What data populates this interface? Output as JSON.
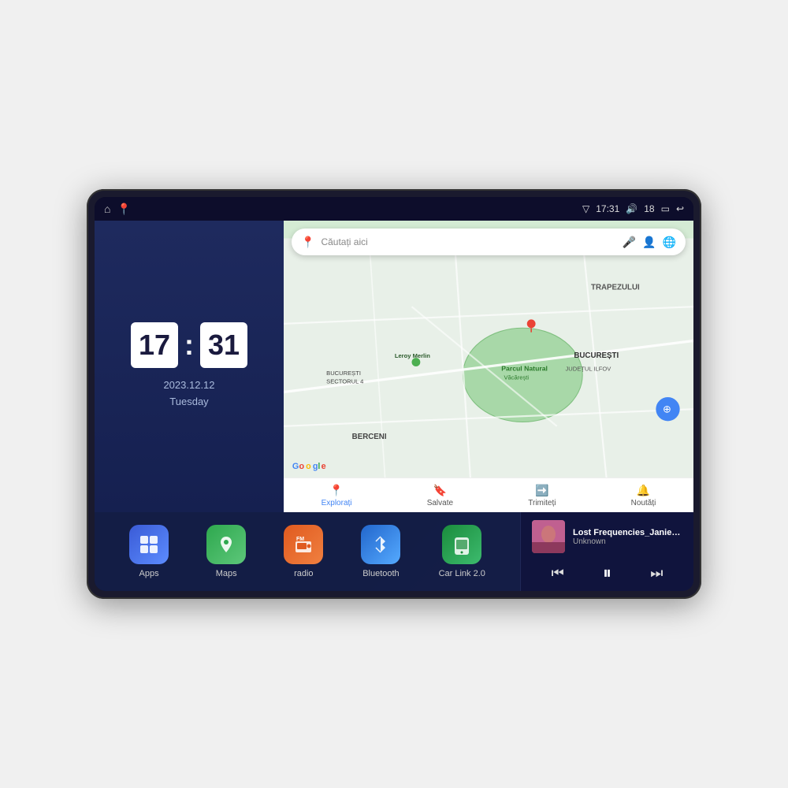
{
  "device": {
    "title": "Car Android Head Unit"
  },
  "status_bar": {
    "left_icons": [
      "home",
      "maps"
    ],
    "time": "17:31",
    "signal_icon": "signal",
    "volume_label": "18",
    "battery_icon": "battery",
    "back_icon": "back"
  },
  "clock": {
    "hour": "17",
    "minute": "31",
    "date": "2023.12.12",
    "day": "Tuesday"
  },
  "map": {
    "search_placeholder": "Căutați aici",
    "brand": "Google",
    "labels": {
      "trapezului": "TRAPEZULUI",
      "bucuresti": "BUCUREȘTI",
      "judet_ilfov": "JUDEȚUL ILFOV",
      "berceni": "BERCENI",
      "parcul": "Parcul Natural Văcărești",
      "leroy": "Leroy Merlin",
      "bucuresti_sector4": "BUCUREȘTI\nSECTORUL 4"
    },
    "nav_items": [
      {
        "icon": "📍",
        "label": "Explorați",
        "active": true
      },
      {
        "icon": "🔖",
        "label": "Salvate",
        "active": false
      },
      {
        "icon": "➡️",
        "label": "Trimiteți",
        "active": false
      },
      {
        "icon": "🔔",
        "label": "Noutăți",
        "active": false
      }
    ]
  },
  "apps": [
    {
      "id": "apps",
      "label": "Apps",
      "icon": "⊞",
      "color_class": "icon-apps"
    },
    {
      "id": "maps",
      "label": "Maps",
      "icon": "📍",
      "color_class": "icon-maps"
    },
    {
      "id": "radio",
      "label": "radio",
      "icon": "📻",
      "color_class": "icon-radio"
    },
    {
      "id": "bluetooth",
      "label": "Bluetooth",
      "icon": "⚡",
      "color_class": "icon-bluetooth"
    },
    {
      "id": "carlink",
      "label": "Car Link 2.0",
      "icon": "📱",
      "color_class": "icon-carlink"
    }
  ],
  "music": {
    "title": "Lost Frequencies_Janieck Devy-...",
    "artist": "Unknown",
    "controls": {
      "prev": "⏮",
      "play": "⏸",
      "next": "⏭"
    }
  }
}
